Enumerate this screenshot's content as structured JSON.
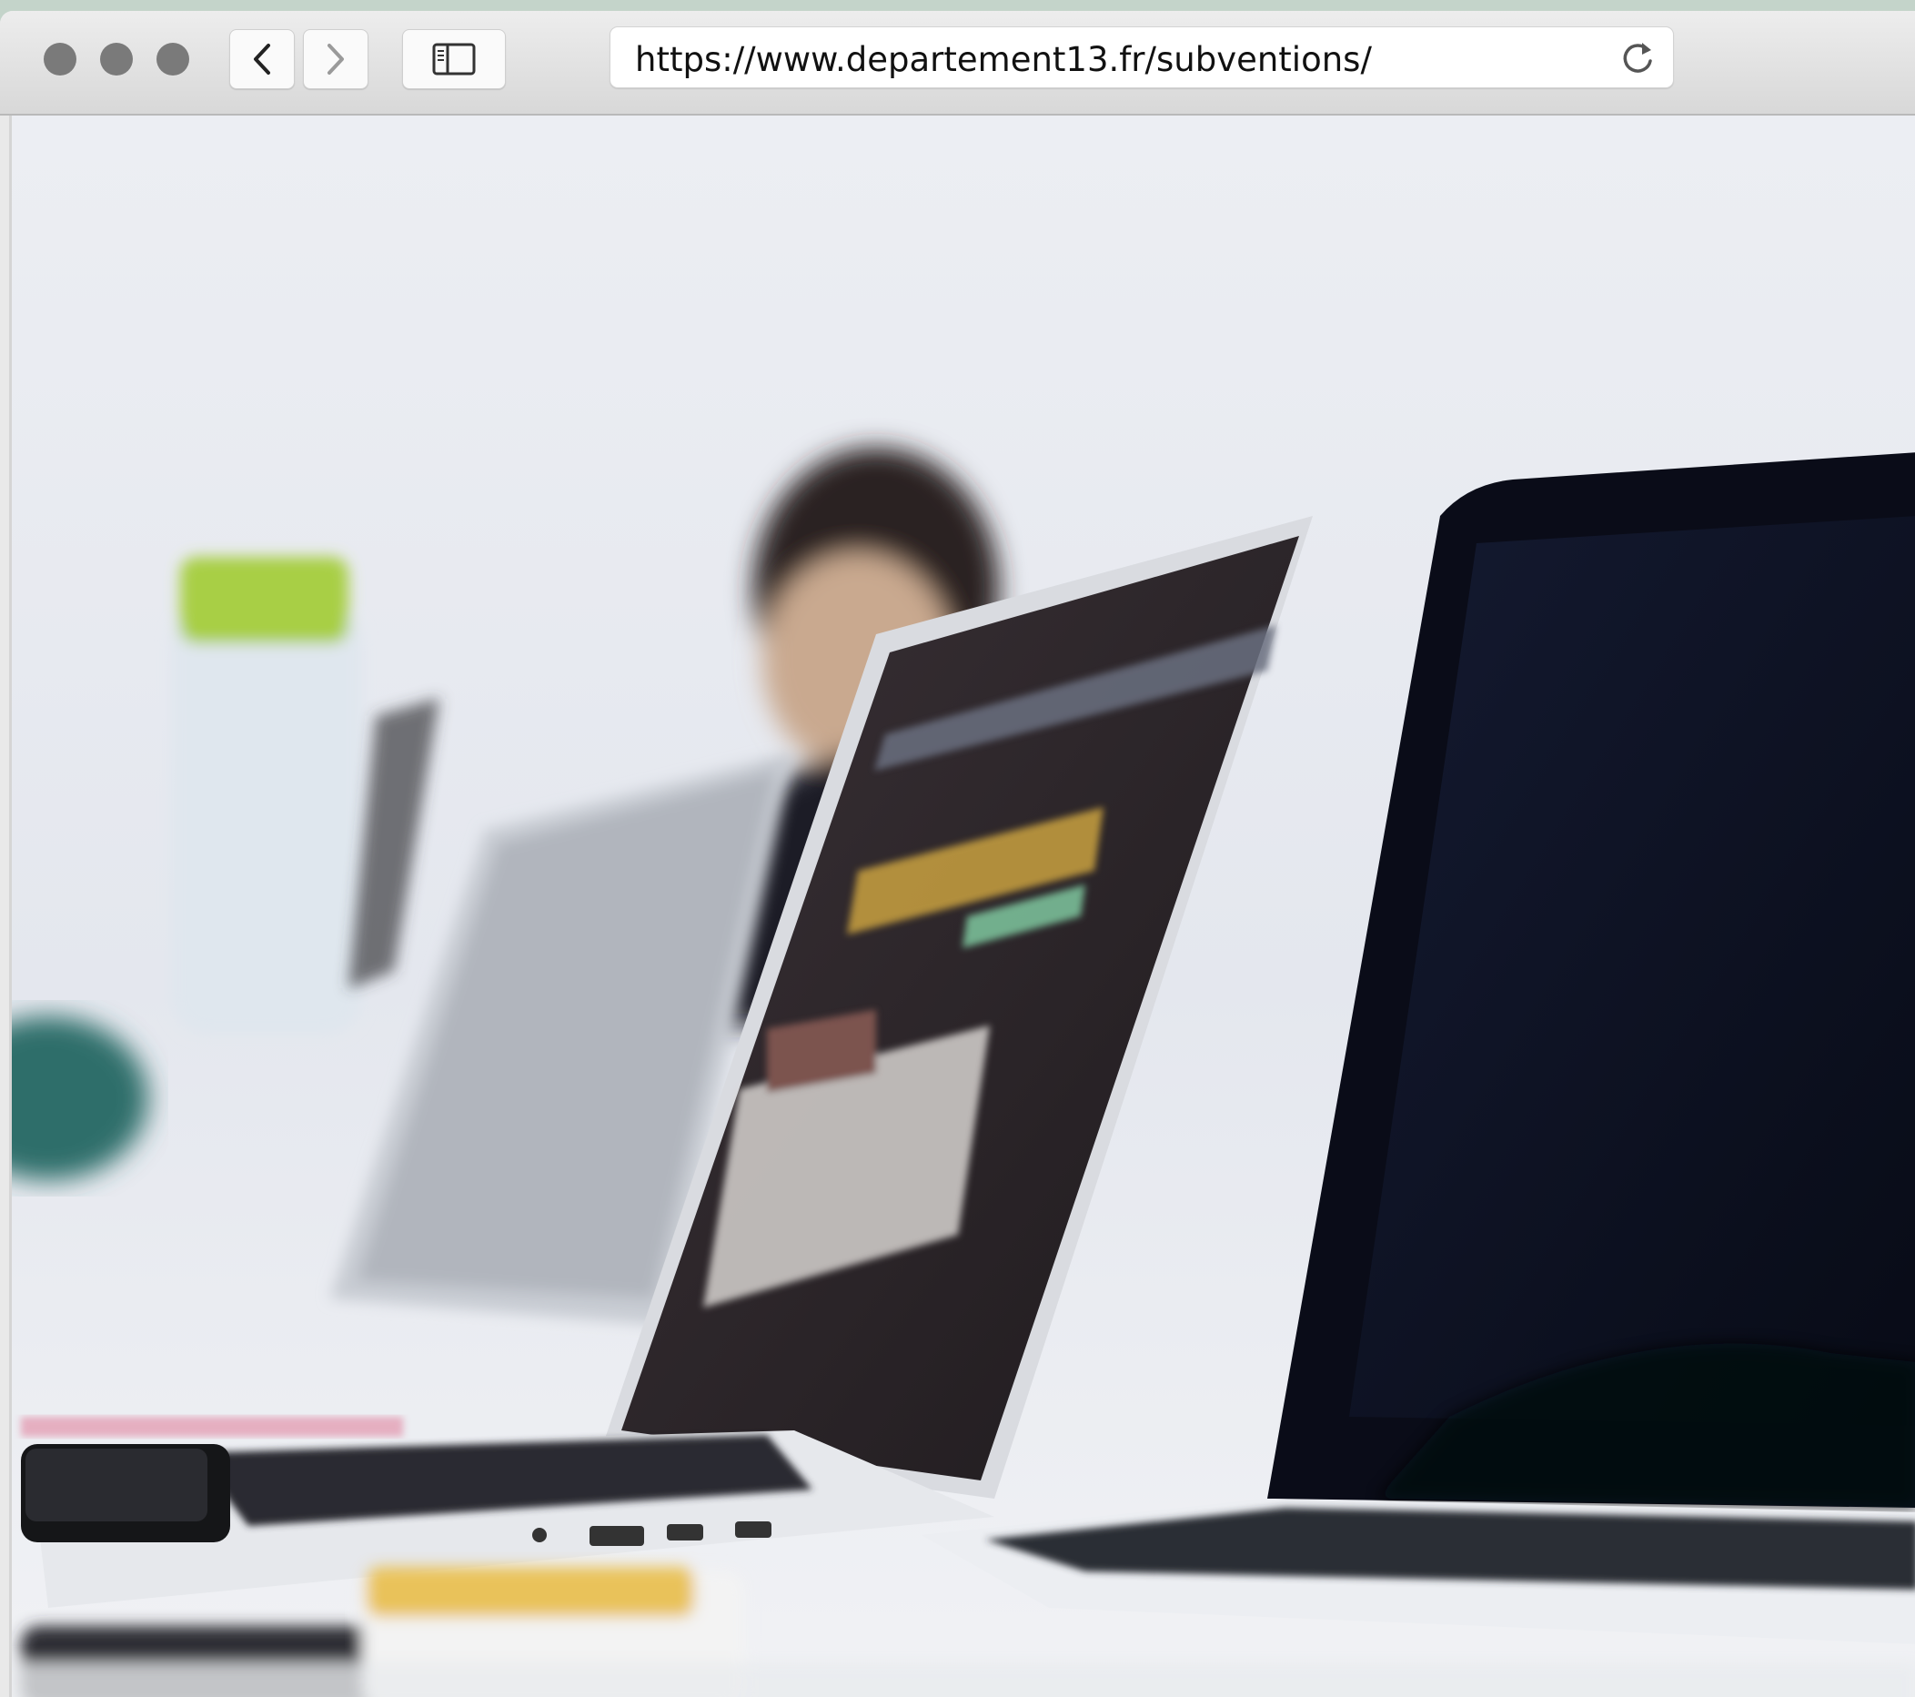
{
  "browser": {
    "url": "https://www.departement13.fr/subventions/",
    "traffic_lights": [
      "close",
      "minimize",
      "zoom"
    ],
    "nav": {
      "back_icon": "chevron-left-icon",
      "forward_icon": "chevron-right-icon"
    },
    "sidebar_icon": "sidebar-icon",
    "reload_icon": "reload-icon"
  },
  "content": {
    "image_description_icon": "photo",
    "colors": {
      "accent_lime": "#a8cf45",
      "accent_yellow": "#e9c25a",
      "screen_dark": "#0d1224"
    }
  }
}
